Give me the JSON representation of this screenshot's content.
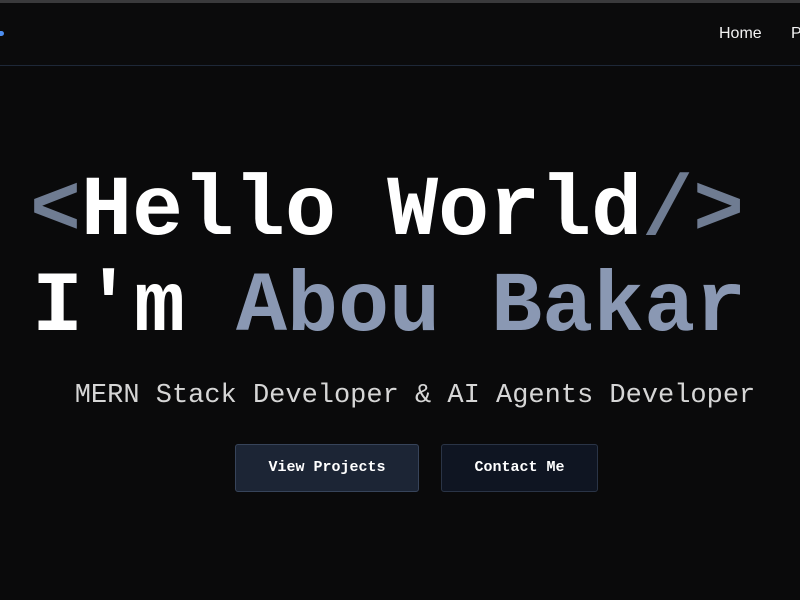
{
  "navbar": {
    "links": [
      "Home",
      "Projects"
    ]
  },
  "hero": {
    "line1": {
      "open_tag": "<",
      "text": "Hello World",
      "close_tag": "/>"
    },
    "line2": {
      "prefix": "I'm ",
      "name": "Abou Bakar"
    },
    "subtitle": "MERN Stack Developer & AI Agents Developer",
    "buttons": {
      "view_projects": "View Projects",
      "contact_me": "Contact Me"
    }
  },
  "colors": {
    "background": "#0a0a0b",
    "accent_muted": "#6f7c92",
    "name_accent": "#8a98b3",
    "logo_accent": "#4d8ef0"
  }
}
